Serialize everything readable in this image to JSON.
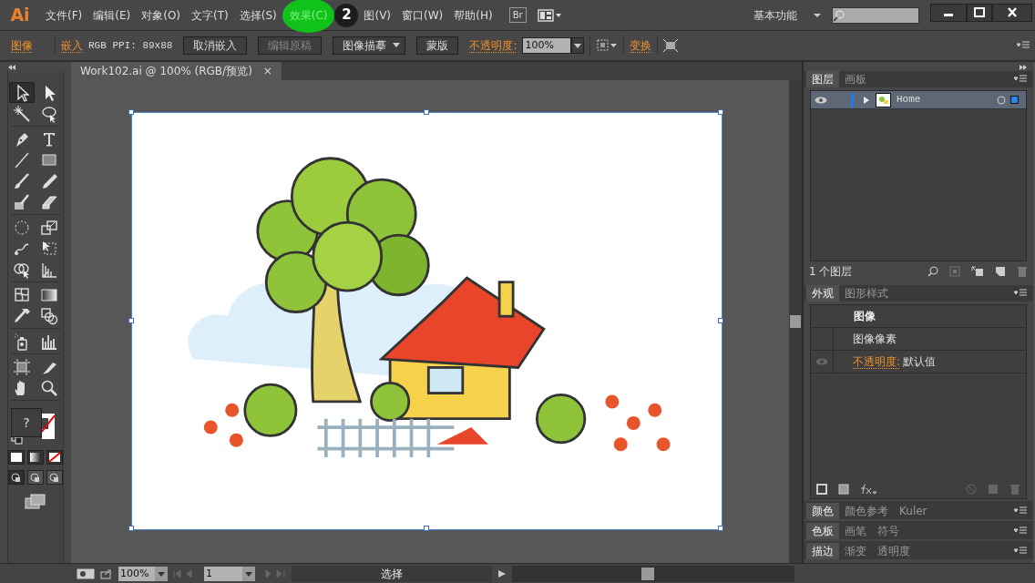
{
  "app": {
    "logo": "Ai"
  },
  "menu": [
    {
      "label": "文件(F)",
      "highlighted": false
    },
    {
      "label": "编辑(E)",
      "highlighted": false
    },
    {
      "label": "对象(O)",
      "highlighted": false
    },
    {
      "label": "文字(T)",
      "highlighted": false
    },
    {
      "label": "选择(S)",
      "highlighted": false
    },
    {
      "label": "效果(C)",
      "highlighted": true
    },
    {
      "label": "图(V)",
      "highlighted": false
    },
    {
      "label": "窗口(W)",
      "highlighted": false
    },
    {
      "label": "帮助(H)",
      "highlighted": false
    }
  ],
  "step_badge": "2",
  "bridge_button": "Br",
  "workspace": "基本功能",
  "control_bar": {
    "object_type": "图像",
    "embed_link": "嵌入",
    "color_info": "RGB  PPI: 89x88",
    "buttons": [
      {
        "label": "取消嵌入",
        "disabled": false,
        "dropdown": false
      },
      {
        "label": "编辑原稿",
        "disabled": true,
        "dropdown": false
      },
      {
        "label": "图像描摹",
        "disabled": false,
        "dropdown": true
      },
      {
        "label": "蒙版",
        "disabled": false,
        "dropdown": false
      }
    ],
    "opacity_label": "不透明度:",
    "opacity_value": "100%",
    "transform_link": "变换"
  },
  "document": {
    "tab": "Work102.ai @ 100% (RGB/预览)",
    "close": "×"
  },
  "tools": [
    {
      "selected": true
    },
    {
      "selected": false
    },
    {
      "selected": false
    },
    {
      "selected": false
    },
    {
      "selected": false
    },
    {
      "selected": false
    },
    {
      "selected": false
    },
    {
      "selected": false
    },
    {
      "selected": false
    },
    {
      "selected": false
    },
    {
      "selected": false
    },
    {
      "selected": false
    },
    {
      "selected": false
    },
    {
      "selected": false
    },
    {
      "selected": false
    },
    {
      "selected": false
    },
    {
      "selected": false
    },
    {
      "selected": false
    },
    {
      "selected": false
    },
    {
      "selected": false
    },
    {
      "selected": false
    },
    {
      "selected": false
    },
    {
      "selected": false
    },
    {
      "selected": false
    },
    {
      "selected": false
    },
    {
      "selected": false
    },
    {
      "selected": false
    },
    {
      "selected": false
    }
  ],
  "fill_stroke": {
    "fill_label": "?"
  },
  "layers_panel": {
    "tabs": [
      {
        "label": "图层",
        "selected": true
      },
      {
        "label": "画板",
        "selected": false
      }
    ],
    "layers": [
      {
        "name": "Home",
        "visible": true,
        "selected": true
      }
    ],
    "count": "1 个图层"
  },
  "appearance_panel": {
    "tabs": [
      {
        "label": "外观",
        "selected": true
      },
      {
        "label": "图形样式",
        "selected": false
      }
    ],
    "title": "图像",
    "rows": [
      {
        "label": "图像像素",
        "visible": false
      },
      {
        "label": "不透明度:",
        "value": "默认值",
        "visible": true
      }
    ]
  },
  "collapsed_panels": [
    {
      "tabs": [
        {
          "label": "颜色",
          "selected": true
        },
        {
          "label": "颜色参考",
          "selected": false
        },
        {
          "label": "Kuler",
          "selected": false
        }
      ]
    },
    {
      "tabs": [
        {
          "label": "色板",
          "selected": true
        },
        {
          "label": "画笔",
          "selected": false
        },
        {
          "label": "符号",
          "selected": false
        }
      ]
    },
    {
      "tabs": [
        {
          "label": "描边",
          "selected": true
        },
        {
          "label": "渐变",
          "selected": false
        },
        {
          "label": "透明度",
          "selected": false
        }
      ]
    }
  ],
  "status_bar": {
    "zoom": "100%",
    "page": "1",
    "tool": "选择"
  }
}
